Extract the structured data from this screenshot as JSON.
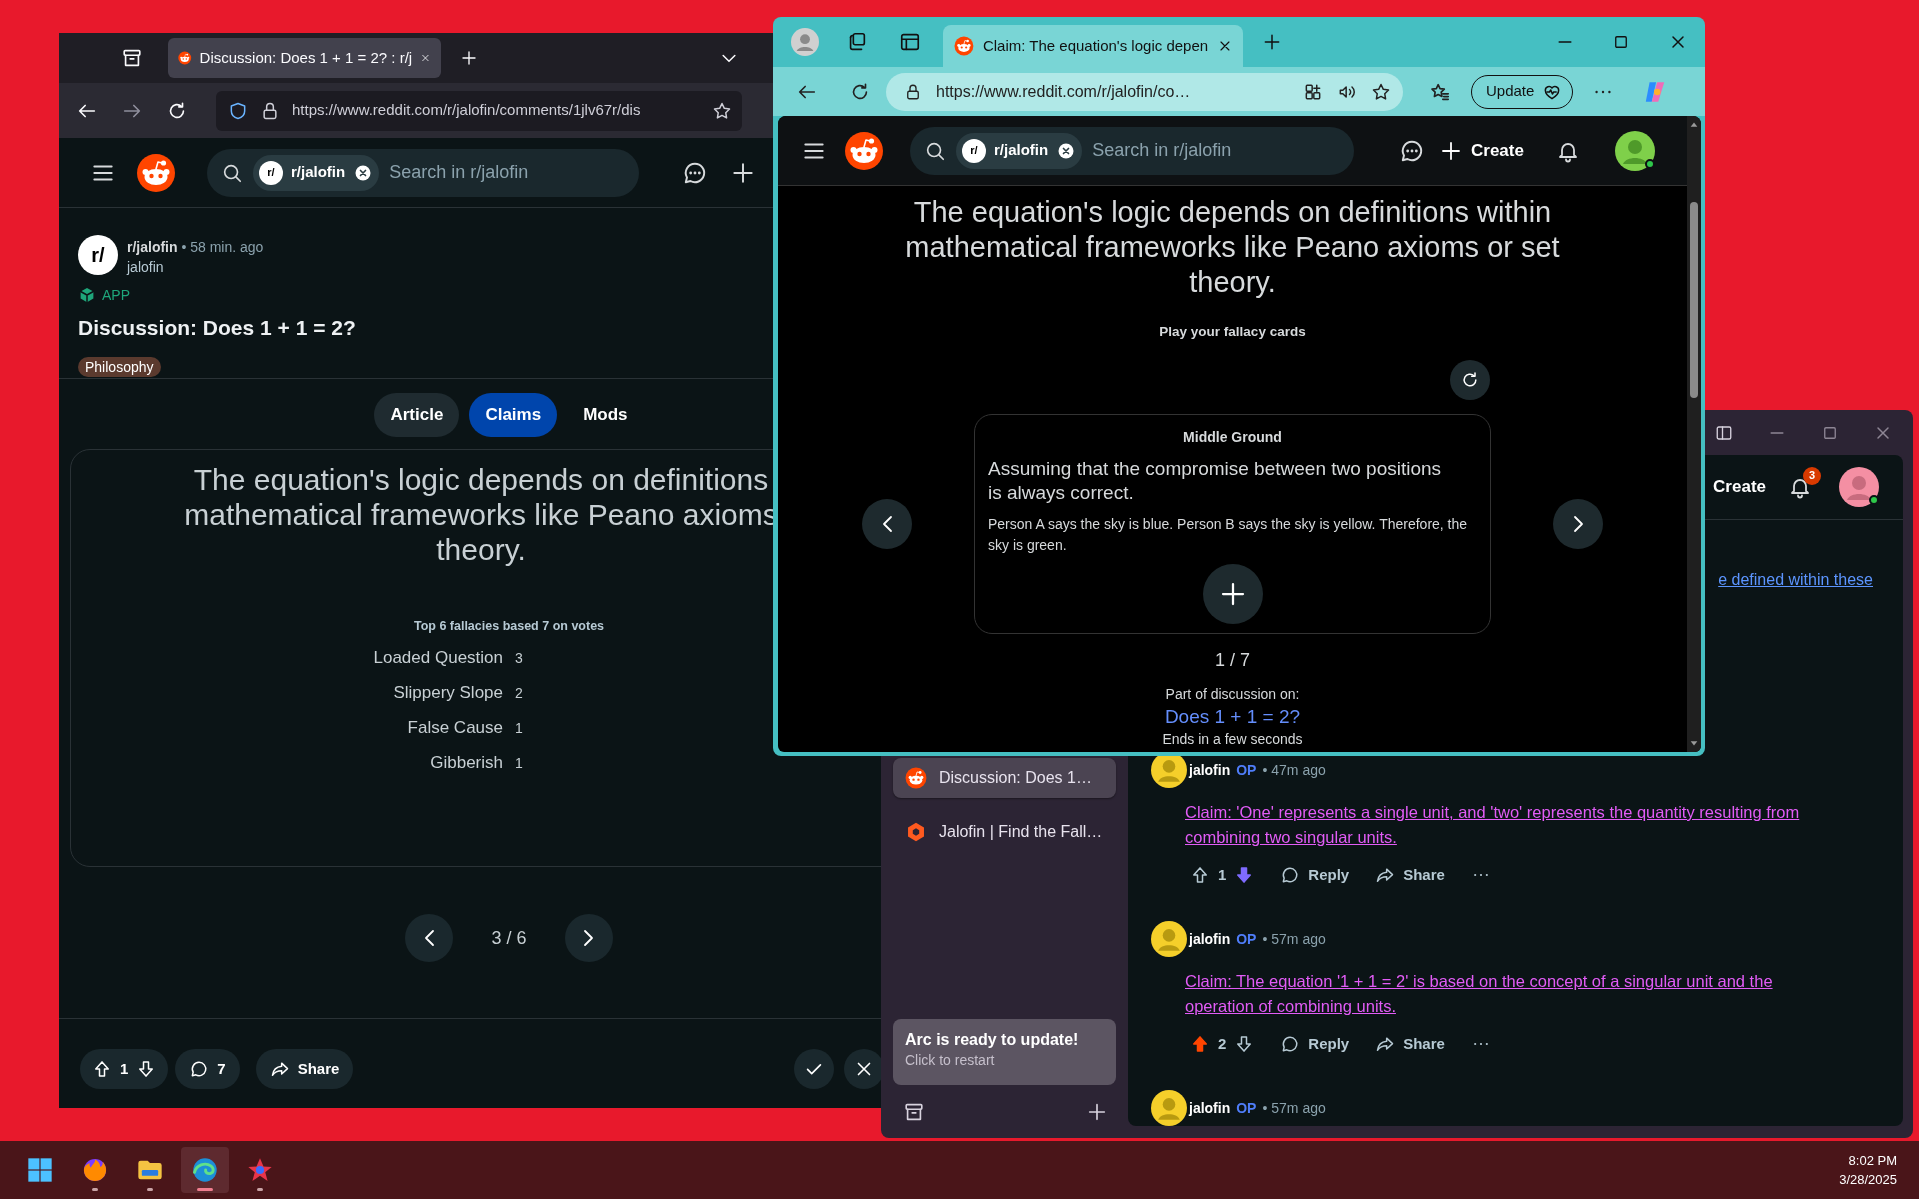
{
  "firefox_window": {
    "tab": {
      "title": "Discussion: Does 1 + 1 = 2? : r/j",
      "selected": true
    },
    "url": "https://www.reddit.com/r/jalofin/comments/1jlv67r/dis",
    "search": {
      "chip_icon": "r/",
      "chip": "r/jalofin",
      "placeholder": "Search in r/jalofin"
    },
    "post": {
      "community_icon": "r/",
      "community": "r/jalofin",
      "time": "• 58 min. ago",
      "author": "jalofin",
      "badge": "APP",
      "title": "Discussion: Does 1 + 1 = 2?",
      "flair": "Philosophy"
    },
    "tabs": [
      {
        "label": "Article",
        "selected": false
      },
      {
        "label": "Claims",
        "selected": true
      },
      {
        "label": "Mods",
        "selected": false
      }
    ],
    "claim_lines": [
      "The equation's logic depends on definitions",
      "mathematical frameworks like Peano axioms",
      "theory."
    ],
    "fallacies_heading": "Top 6 fallacies based 7 on votes",
    "fallacies": [
      {
        "name": "Loaded Question",
        "count": "3"
      },
      {
        "name": "Slippery Slope",
        "count": "2"
      },
      {
        "name": "False Cause",
        "count": "1"
      },
      {
        "name": "Gibberish",
        "count": "1"
      }
    ],
    "pager": "3 / 6",
    "votes": "1",
    "comments": "7",
    "share": "Share"
  },
  "edge_window": {
    "tab": {
      "title": "Claim: The equation's logic depen",
      "selected": true
    },
    "url": "https://www.reddit.com/r/jalofin/co…",
    "update_button": "Update",
    "search": {
      "chip_icon": "r/",
      "chip": "r/jalofin",
      "placeholder": "Search in r/jalofin"
    },
    "create": "Create",
    "claim": "The equation's logic depends on definitions within mathematical frameworks like Peano axioms or set theory.",
    "prompt": "Play your fallacy cards",
    "card": {
      "title": "Middle Ground",
      "definition": "Assuming that the compromise between two positions is always correct.",
      "example": "Person A says the sky is blue. Person B says the sky is yellow. Therefore, the sky is green."
    },
    "pager": "1 / 7",
    "discussion_label": "Part of discussion on:",
    "discussion_link": "Does 1 + 1 = 2?",
    "ends": "Ends in a few seconds"
  },
  "arc_window": {
    "sidebar_tabs": [
      {
        "title": "Discussion: Does 1…",
        "selected": true,
        "kind": "reddit"
      },
      {
        "title": "Jalofin | Find the Fall…",
        "selected": false,
        "kind": "hexagon"
      }
    ],
    "update": {
      "title": "Arc is ready to update!",
      "subtitle": "Click to restart"
    },
    "create": "Create",
    "notifications": "3",
    "link_fragment": "e defined within these",
    "comments": [
      {
        "author": "jalofin",
        "op": "OP",
        "time": "• 47m ago",
        "text": "Claim: 'One' represents a single unit, and 'two' represents the quantity resulting from combining two singular units.",
        "score": "1",
        "upvoted": false,
        "downvoted": true,
        "reply": "Reply",
        "share": "Share"
      },
      {
        "author": "jalofin",
        "op": "OP",
        "time": "• 57m ago",
        "text": "Claim: The equation '1 + 1 = 2' is based on the concept of a singular unit and the operation of combining units.",
        "score": "2",
        "upvoted": true,
        "downvoted": false,
        "reply": "Reply",
        "share": "Share"
      },
      {
        "author": "jalofin",
        "op": "OP",
        "time": "• 57m ago"
      }
    ]
  },
  "taskbar": {
    "apps": [
      {
        "kind": "start",
        "running": false,
        "selected": false
      },
      {
        "kind": "fox",
        "running": true,
        "selected": false
      },
      {
        "kind": "folder",
        "running": true,
        "selected": false
      },
      {
        "kind": "wave",
        "running": true,
        "selected": true
      },
      {
        "kind": "star",
        "running": true,
        "selected": false
      }
    ],
    "time": "8:02 PM",
    "date": "3/28/2025"
  }
}
